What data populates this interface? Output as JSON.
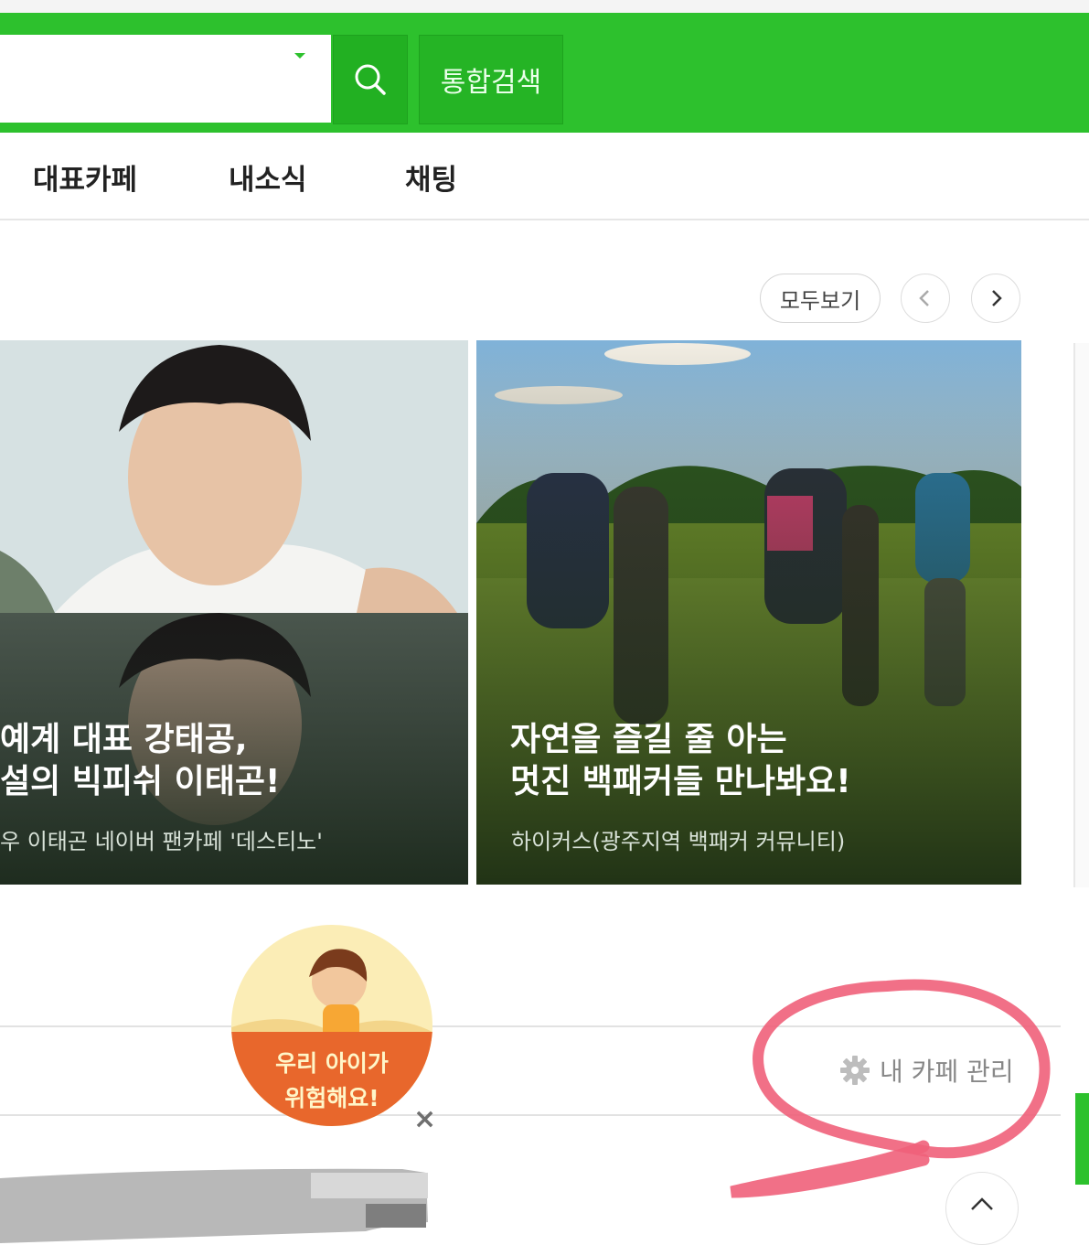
{
  "header": {
    "search_placeholder": "",
    "total_search_label": "통합검색"
  },
  "tabs": [
    "대표카페",
    "내소식",
    "채팅"
  ],
  "carousel": {
    "view_all_label": "모두보기",
    "cards": [
      {
        "title_line1": "예계 대표 강태공,",
        "title_line2": "설의 빅피쉬 이태곤!",
        "subtitle": "우 이태곤 네이버 팬카페 '데스티노'"
      },
      {
        "title_line1": "자연을 즐길 줄 아는",
        "title_line2": "멋진 백패커들 만나봐요!",
        "subtitle": "하이커스(광주지역 백패커 커뮤니티)"
      }
    ]
  },
  "promo": {
    "line1": "우리 아이가",
    "line2": "위험해요!",
    "close": "×"
  },
  "my_cafe": {
    "manage_label": "내 카페 관리"
  },
  "icons": {
    "search": "search-icon",
    "prev": "chevron-left-icon",
    "next": "chevron-right-icon",
    "settings": "gear-icon",
    "scroll_top": "chevron-up-icon"
  },
  "colors": {
    "brand_green": "#2dc12d",
    "annotation_pink": "#f0607a",
    "promo_orange": "#e8672c"
  }
}
